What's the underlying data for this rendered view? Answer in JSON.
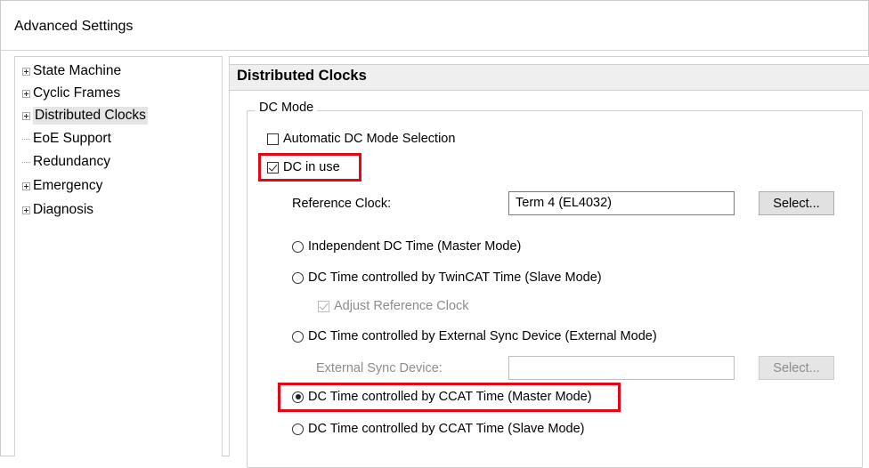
{
  "window": {
    "title": "Advanced Settings"
  },
  "tree": {
    "items": [
      {
        "label": "State Machine",
        "expandable": true,
        "selected": false
      },
      {
        "label": "Cyclic Frames",
        "expandable": true,
        "selected": false
      },
      {
        "label": "Distributed Clocks",
        "expandable": true,
        "selected": true
      },
      {
        "label": "EoE Support",
        "expandable": false,
        "selected": false
      },
      {
        "label": "Redundancy",
        "expandable": false,
        "selected": false
      },
      {
        "label": "Emergency",
        "expandable": true,
        "selected": false
      },
      {
        "label": "Diagnosis",
        "expandable": true,
        "selected": false
      }
    ]
  },
  "panel": {
    "header": "Distributed Clocks",
    "group_label": "DC Mode",
    "auto_dc_mode": {
      "label": "Automatic DC Mode Selection",
      "checked": false
    },
    "dc_in_use": {
      "label": "DC in use",
      "checked": true
    },
    "reference_clock": {
      "label": "Reference Clock:",
      "value": "Term 4 (EL4032)",
      "button": "Select..."
    },
    "options": [
      {
        "label": "Independent DC Time (Master Mode)",
        "checked": false
      },
      {
        "label": "DC Time controlled by TwinCAT Time (Slave Mode)",
        "checked": false
      },
      {
        "label": "DC Time controlled by External Sync Device (External Mode)",
        "checked": false
      },
      {
        "label": "DC Time controlled by CCAT Time (Master Mode)",
        "checked": true
      },
      {
        "label": "DC Time controlled by CCAT Time (Slave Mode)",
        "checked": false
      }
    ],
    "adjust_reference_clock": {
      "label": "Adjust Reference Clock",
      "checked": true,
      "disabled": true
    },
    "external_sync_device": {
      "label": "External Sync Device:",
      "value": "",
      "button": "Select..."
    }
  },
  "colors": {
    "highlight": "#e30613",
    "header_bg": "#efefef"
  }
}
